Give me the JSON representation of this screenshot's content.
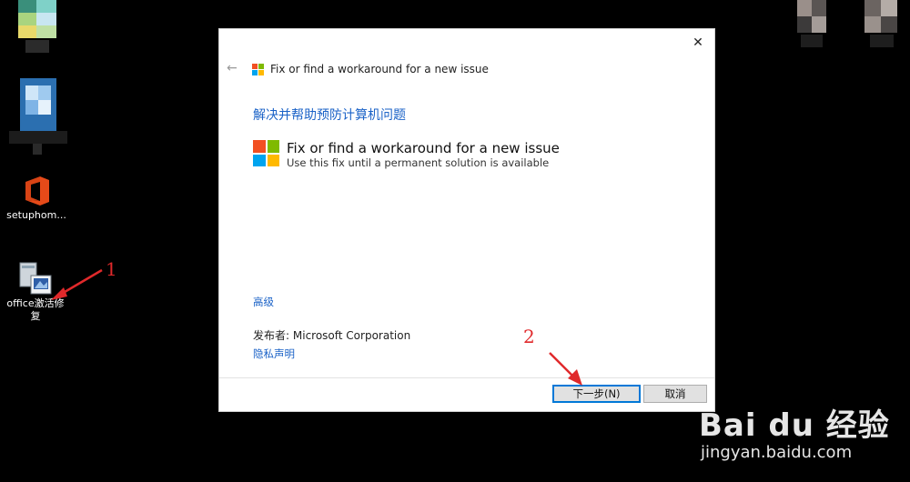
{
  "desktop": {
    "icons": [
      {
        "label": ""
      },
      {
        "label": ""
      },
      {
        "label": "setuphom..."
      },
      {
        "label_line1": "office激活修",
        "label_line2": "复"
      }
    ]
  },
  "dialog": {
    "window_title": "Fix or find a workaround for a new issue",
    "heading": "解决并帮助预防计算机问题",
    "option_title": "Fix or find a workaround for a new issue",
    "option_subtitle": "Use this fix until a permanent solution is available",
    "advanced_link": "高级",
    "publisher_label": "发布者:",
    "publisher_name": "Microsoft Corporation",
    "privacy_link": "隐私声明",
    "next_button": "下一步(N)",
    "cancel_button": "取消",
    "close_glyph": "✕",
    "back_glyph": "←"
  },
  "annotations": {
    "step1": "1",
    "step2": "2",
    "arrow_color": "#e0292b"
  },
  "watermark": {
    "brand": "Bai du 经验",
    "url": "jingyan.baidu.com"
  },
  "colors": {
    "link": "#1a62c7",
    "ms_red": "#f25022",
    "ms_green": "#7fba00",
    "ms_blue": "#00a4ef",
    "ms_yellow": "#ffb900"
  }
}
